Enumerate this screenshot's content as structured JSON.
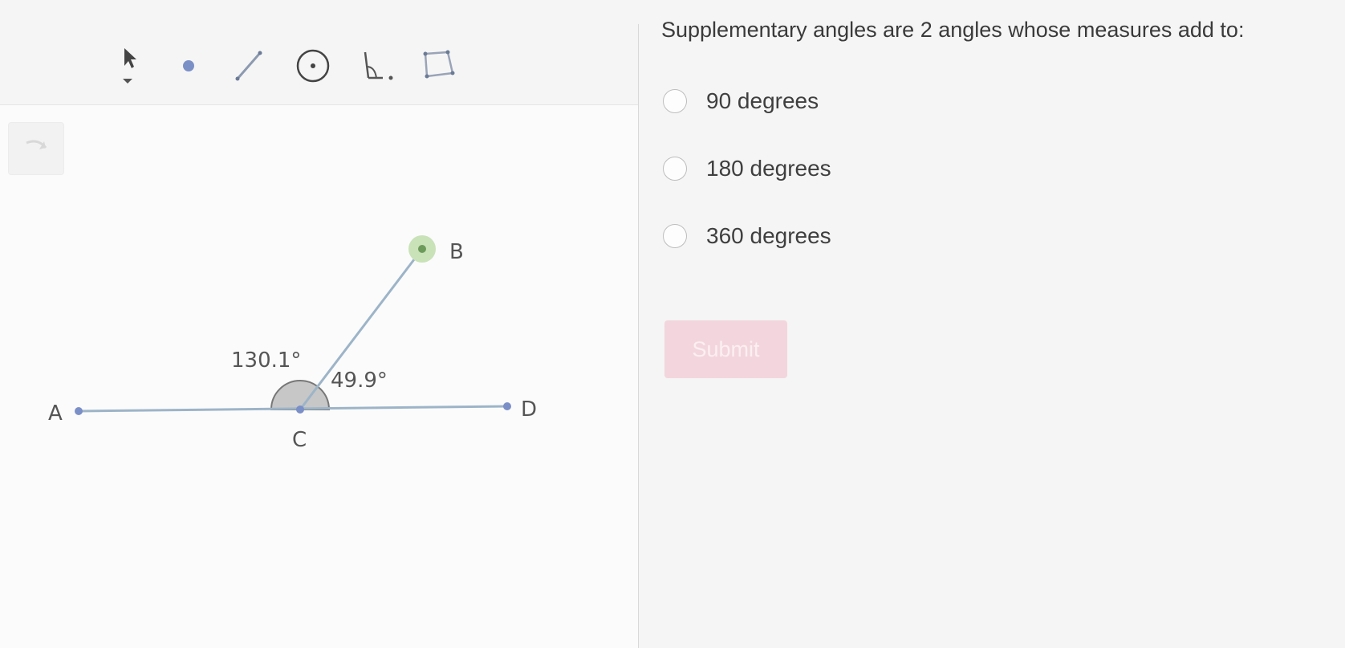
{
  "toolbar": {
    "tools": [
      {
        "name": "move-tool",
        "icon": "arrow-pointer-icon"
      },
      {
        "name": "point-tool",
        "icon": "point-icon"
      },
      {
        "name": "line-tool",
        "icon": "segment-icon"
      },
      {
        "name": "circle-tool",
        "icon": "circle-center-icon"
      },
      {
        "name": "angle-tool",
        "icon": "angle-icon"
      },
      {
        "name": "polygon-tool",
        "icon": "polygon-icon"
      }
    ]
  },
  "figure": {
    "points": {
      "A": "A",
      "B": "B",
      "C": "C",
      "D": "D"
    },
    "angles": {
      "obtuse": "130.1°",
      "acute": "49.9°"
    }
  },
  "question": {
    "prompt": "Supplementary angles are 2 angles whose measures add to:",
    "options": [
      {
        "label": "90 degrees",
        "selected": false
      },
      {
        "label": "180 degrees",
        "selected": false
      },
      {
        "label": "360 degrees",
        "selected": false
      }
    ],
    "submit_label": "Submit",
    "submit_enabled": false
  },
  "colors": {
    "segment": "#9db4c8",
    "point": "#7b8fc7",
    "selected_point_halo": "#c9e2b8",
    "selected_point": "#6c9a5a",
    "angle_fill": "#c7c7c7",
    "submit_bg": "#f3d6dd"
  }
}
